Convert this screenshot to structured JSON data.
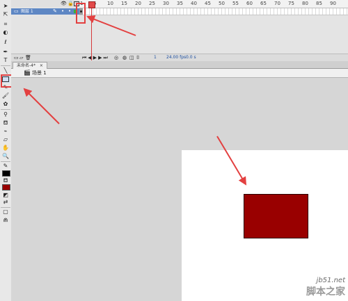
{
  "timeline": {
    "ruler_numbers": [
      "5",
      "10",
      "15",
      "20",
      "25",
      "30",
      "35",
      "40",
      "45",
      "50",
      "55",
      "60",
      "65",
      "70",
      "75",
      "80",
      "85",
      "90"
    ],
    "ruler_start": "1",
    "layer_name": "图层 1",
    "fps": "24.00 fps",
    "time": "0.0 s",
    "current_frame": "1"
  },
  "document": {
    "tab_title": "未命名-4*",
    "scene_name": "场景 1"
  },
  "stage": {
    "rect_color": "#990000"
  },
  "watermark": {
    "site": "jb51.net",
    "name": "脚本之家"
  },
  "colors": {
    "accent": "#e34040",
    "stroke_swatch": "#000000",
    "fill_swatch": "#990000"
  }
}
